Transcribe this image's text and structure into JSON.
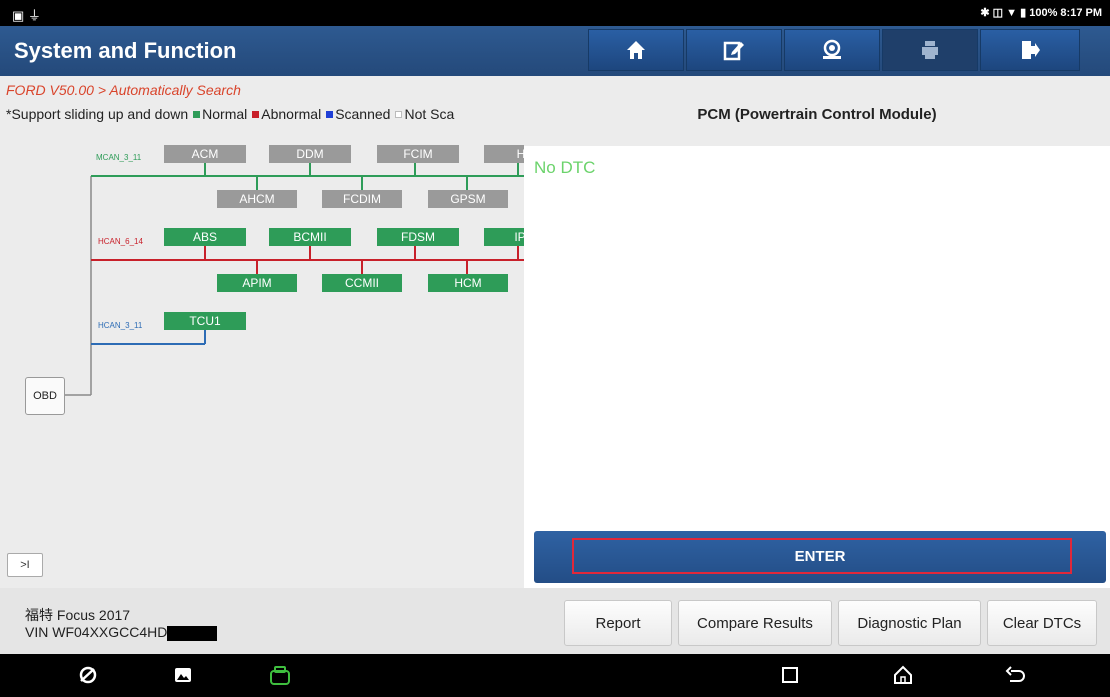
{
  "status_bar": {
    "battery": "100%",
    "time": "8:17 PM"
  },
  "header": {
    "title": "System and Function"
  },
  "left": {
    "breadcrumb": "FORD V50.00 > Automatically Search",
    "legend": {
      "prefix": "*Support sliding up and down",
      "normal": "Normal",
      "abnormal": "Abnormal",
      "scanned": "Scanned",
      "not_scanned": "Not Sca"
    },
    "buses": [
      {
        "name": "MCAN_3_11",
        "color": "#2e9c58"
      },
      {
        "name": "HCAN_6_14",
        "color": "#c8202a"
      },
      {
        "name": "HCAN_3_11",
        "color": "#2d6cb5"
      }
    ],
    "modules": {
      "mcan_top": [
        "ACM",
        "DDM",
        "FCIM",
        "HV"
      ],
      "mcan_bottom": [
        "AHCM",
        "FCDIM",
        "GPSM"
      ],
      "hcan6_top": [
        "ABS",
        "BCMII",
        "FDSM",
        "IPM"
      ],
      "hcan6_bottom": [
        "APIM",
        "CCMII",
        "HCM"
      ],
      "hcan3": [
        "TCU1"
      ]
    },
    "obd": "OBD",
    "collapse": ">I"
  },
  "right": {
    "module_title": "PCM (Powertrain Control Module)",
    "dtc_status": "No DTC",
    "enter_label": "ENTER"
  },
  "vehicle": {
    "name": "福特 Focus 2017",
    "vin_prefix": "VIN WF04XXGCC4HD"
  },
  "buttons": {
    "report": "Report",
    "compare": "Compare Results",
    "plan": "Diagnostic Plan",
    "clear": "Clear DTCs"
  },
  "colors": {
    "normal": "#2e9c58",
    "abnormal": "#c8202a",
    "scanned": "#1f3fd6",
    "header": "#2a5492",
    "enter": "#2a5a98",
    "no_dtc": "#6bd36b"
  }
}
